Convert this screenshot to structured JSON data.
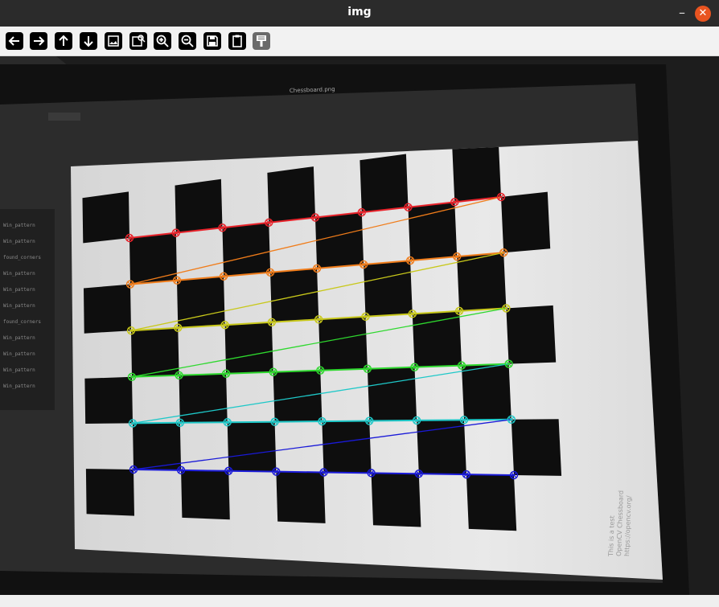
{
  "window": {
    "title": "img",
    "minimize_glyph": "–",
    "close_glyph": "✕"
  },
  "toolbar": {
    "buttons": [
      {
        "name": "pan-left",
        "icon": "arrow-left-icon"
      },
      {
        "name": "pan-right",
        "icon": "arrow-right-icon"
      },
      {
        "name": "pan-up",
        "icon": "arrow-up-icon"
      },
      {
        "name": "pan-down",
        "icon": "arrow-down-icon"
      },
      {
        "name": "zoom-fit",
        "icon": "image-icon"
      },
      {
        "name": "zoom-original",
        "icon": "image-search-icon"
      },
      {
        "name": "zoom-in",
        "icon": "zoom-in-icon"
      },
      {
        "name": "zoom-out",
        "icon": "zoom-out-icon"
      },
      {
        "name": "save",
        "icon": "save-icon"
      },
      {
        "name": "copy-clipboard",
        "icon": "clipboard-icon"
      },
      {
        "name": "properties",
        "icon": "paint-brush-icon"
      }
    ]
  },
  "image": {
    "screen_title": "Chessboard.png",
    "paper_caption": [
      "This is a test",
      "OpenCV Chessboard",
      "https://opencv.org/"
    ],
    "terminal_lines": [
      "Win_pattern",
      "Win_pattern",
      "found_corners",
      "Win_pattern",
      "Win_pattern",
      "Win_pattern",
      "found_corners",
      "Win_pattern",
      "Win_pattern",
      "Win_pattern",
      "Win_pattern"
    ],
    "row_colors": [
      "#e8232b",
      "#f07c1a",
      "#c8c81a",
      "#2ed82e",
      "#1ec8c8",
      "#1a1ad8"
    ],
    "corner_rows": 6,
    "corner_cols": 9
  },
  "status": {
    "text": ""
  }
}
